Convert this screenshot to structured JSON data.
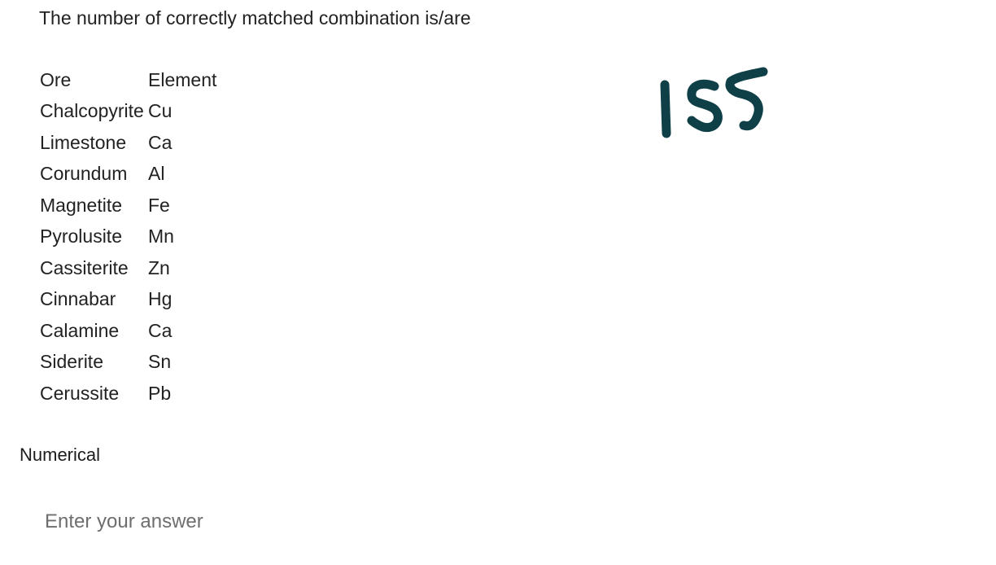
{
  "question": {
    "text": "The number of correctly matched combination is/are"
  },
  "table": {
    "headers": [
      "Ore",
      "Element"
    ],
    "rows": [
      {
        "ore": "Chalcopyrite",
        "element": "Cu"
      },
      {
        "ore": "Limestone",
        "element": "Ca"
      },
      {
        "ore": "Corundum",
        "element": "Al"
      },
      {
        "ore": "Magnetite",
        "element": "Fe"
      },
      {
        "ore": "Pyrolusite",
        "element": "Mn"
      },
      {
        "ore": "Cassiterite",
        "element": "Zn"
      },
      {
        "ore": "Cinnabar",
        "element": "Hg"
      },
      {
        "ore": "Calamine",
        "element": "Ca"
      },
      {
        "ore": "Siderite",
        "element": "Sn"
      },
      {
        "ore": "Cerussite",
        "element": "Pb"
      }
    ]
  },
  "section": {
    "label": "Numerical"
  },
  "answer": {
    "placeholder": "Enter your answer",
    "value": ""
  },
  "annotation": {
    "handwritten_text": "155",
    "ink_color": "#0f3f47"
  }
}
